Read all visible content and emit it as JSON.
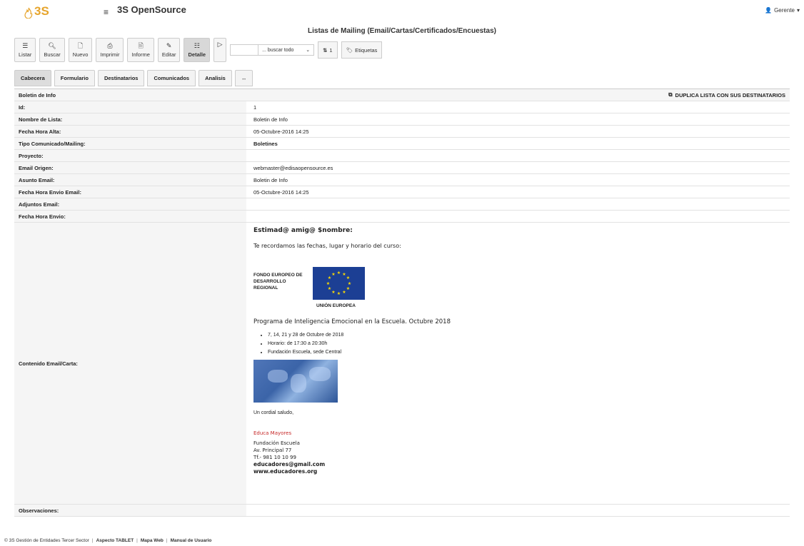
{
  "app": {
    "logo": "3S",
    "brand": "3S OpenSource",
    "user": "Gerente"
  },
  "page": {
    "title": "Listas de Mailing (Email/Cartas/Certificados/Encuestas)"
  },
  "toolbar": {
    "listar": "Listar",
    "buscar": "Buscar",
    "nuevo": "Nuevo",
    "imprimir": "Imprimir",
    "informe": "Informe",
    "editar": "Editar",
    "detalle": "Detalle",
    "search_select": "... buscar todo",
    "counter": "1",
    "etiquetas": "Etiquetas"
  },
  "tabs": [
    "Cabecera",
    "Formulario",
    "Destinatarios",
    "Comunicados",
    "Analisis",
    "↔"
  ],
  "form": {
    "section_title": "Boletin de Info",
    "duplicate_action": "DUPLICA LISTA CON SUS DESTINATARIOS",
    "fields": [
      {
        "label": "Id:",
        "value": "1"
      },
      {
        "label": "Nombre de Lista:",
        "value": "Boletin de Info"
      },
      {
        "label": "Fecha Hora Alta:",
        "value": "05-Octubre-2016  14:25"
      },
      {
        "label": "Tipo Comunicado/Mailing:",
        "value": "Boletines"
      },
      {
        "label": "Proyecto:",
        "value": ""
      },
      {
        "label": "Email Origen:",
        "value": "webmaster@edisaopensource.es"
      },
      {
        "label": "Asunto Email:",
        "value": "Boletin de Info"
      },
      {
        "label": "Fecha Hora Envio Email:",
        "value": "05-Octubre-2016  14:25"
      },
      {
        "label": "Adjuntos Email:",
        "value": ""
      },
      {
        "label": "Fecha Hora Envio:",
        "value": ""
      }
    ],
    "content_label": "Contenido Email/Carta:",
    "observaciones_label": "Observaciones:"
  },
  "email": {
    "greeting": "Estimad@ amig@ $nombre:",
    "intro": "Te recordamos las fechas, lugar y horario del curso:",
    "feder_text": "FONDO EUROPEO DE DESARROLLO REGIONAL",
    "eu_caption": "UNIÓN EUROPEA",
    "program": "Programa de Inteligencia Emocional en la Escuela. Octubre 2018",
    "bullets": [
      "7, 14, 21 y 28 de Octubre de 2018",
      "Horario: de 17:30 a 20:30h",
      "Fundación Escuela, sede Central"
    ],
    "saludo": "Un cordial saludo,",
    "org_name": "Educa Mayores",
    "org_lines": [
      "Fundación Escuela",
      "Av. Principal 77",
      "Tf.- 981 10 10 99"
    ],
    "org_email": "educadores@gmail.com",
    "org_web": "www.educadores.org"
  },
  "footer": {
    "copyright": "© 3S Gestión de Entidades Tercer Sector",
    "aspecto": "Aspecto TABLET",
    "mapa": "Mapa Web",
    "manual": "Manual de Usuario"
  },
  "colors": {
    "logo": "#e6a42b",
    "eu_blue": "#1c3f94",
    "accent_red": "#c62828"
  }
}
